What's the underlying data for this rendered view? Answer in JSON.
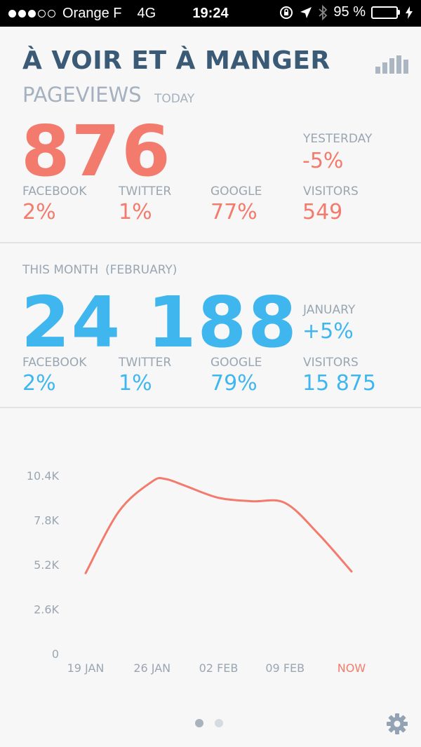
{
  "status_bar": {
    "carrier": "Orange F",
    "network": "4G",
    "time": "19:24",
    "battery": "95 %",
    "battery_level": 0.95,
    "icons": [
      "signal-dots-icon",
      "orientation-lock-icon",
      "location-arrow-icon",
      "bluetooth-icon",
      "battery-icon",
      "charging-bolt-icon"
    ]
  },
  "header": {
    "title": "À VOIR ET À MANGER",
    "stats_icon": "bar-chart-icon"
  },
  "today": {
    "section_label": "PAGEVIEWS",
    "period_label": "TODAY",
    "total": "876",
    "comparison_label": "YESTERDAY",
    "comparison_value": "-5%",
    "breakdown": [
      {
        "label": "FACEBOOK",
        "value": "2%"
      },
      {
        "label": "TWITTER",
        "value": "1%"
      },
      {
        "label": "GOOGLE",
        "value": "77%"
      },
      {
        "label": "VISITORS",
        "value": "549"
      }
    ]
  },
  "month": {
    "period_label": "THIS MONTH",
    "month_name": "(FEBRUARY)",
    "total": "24 188",
    "comparison_label": "JANUARY",
    "comparison_value": "+5%",
    "breakdown": [
      {
        "label": "FACEBOOK",
        "value": "2%"
      },
      {
        "label": "TWITTER",
        "value": "1%"
      },
      {
        "label": "GOOGLE",
        "value": "79%"
      },
      {
        "label": "VISITORS",
        "value": "15 875"
      }
    ]
  },
  "chart_data": {
    "type": "line",
    "categories": [
      "19 JAN",
      "26 JAN",
      "02 FEB",
      "09 FEB",
      "NOW"
    ],
    "x_positions": [
      0,
      1,
      2,
      3,
      4
    ],
    "y_ticks": [
      "10.4K",
      "7.8K",
      "5.2K",
      "2.6K",
      "0"
    ],
    "y_tick_values": [
      10400,
      7800,
      5200,
      2600,
      0
    ],
    "ylim": [
      0,
      10400
    ],
    "series": [
      {
        "color": "#f37b6d",
        "points": [
          [
            0,
            4700
          ],
          [
            0.5,
            8300
          ],
          [
            1,
            10050
          ],
          [
            1.2,
            10200
          ],
          [
            1.5,
            9800
          ],
          [
            2,
            9100
          ],
          [
            2.5,
            8900
          ],
          [
            3,
            8800
          ],
          [
            3.5,
            7000
          ],
          [
            4,
            4800
          ]
        ]
      }
    ],
    "highlight_category": "NOW",
    "colors": {
      "line": "#f37b6d",
      "axis_text": "#9aa6b2",
      "highlight": "#f37b6d"
    }
  },
  "pager": {
    "count": 2,
    "active": 0
  },
  "footer": {
    "settings_icon": "gear-icon"
  }
}
